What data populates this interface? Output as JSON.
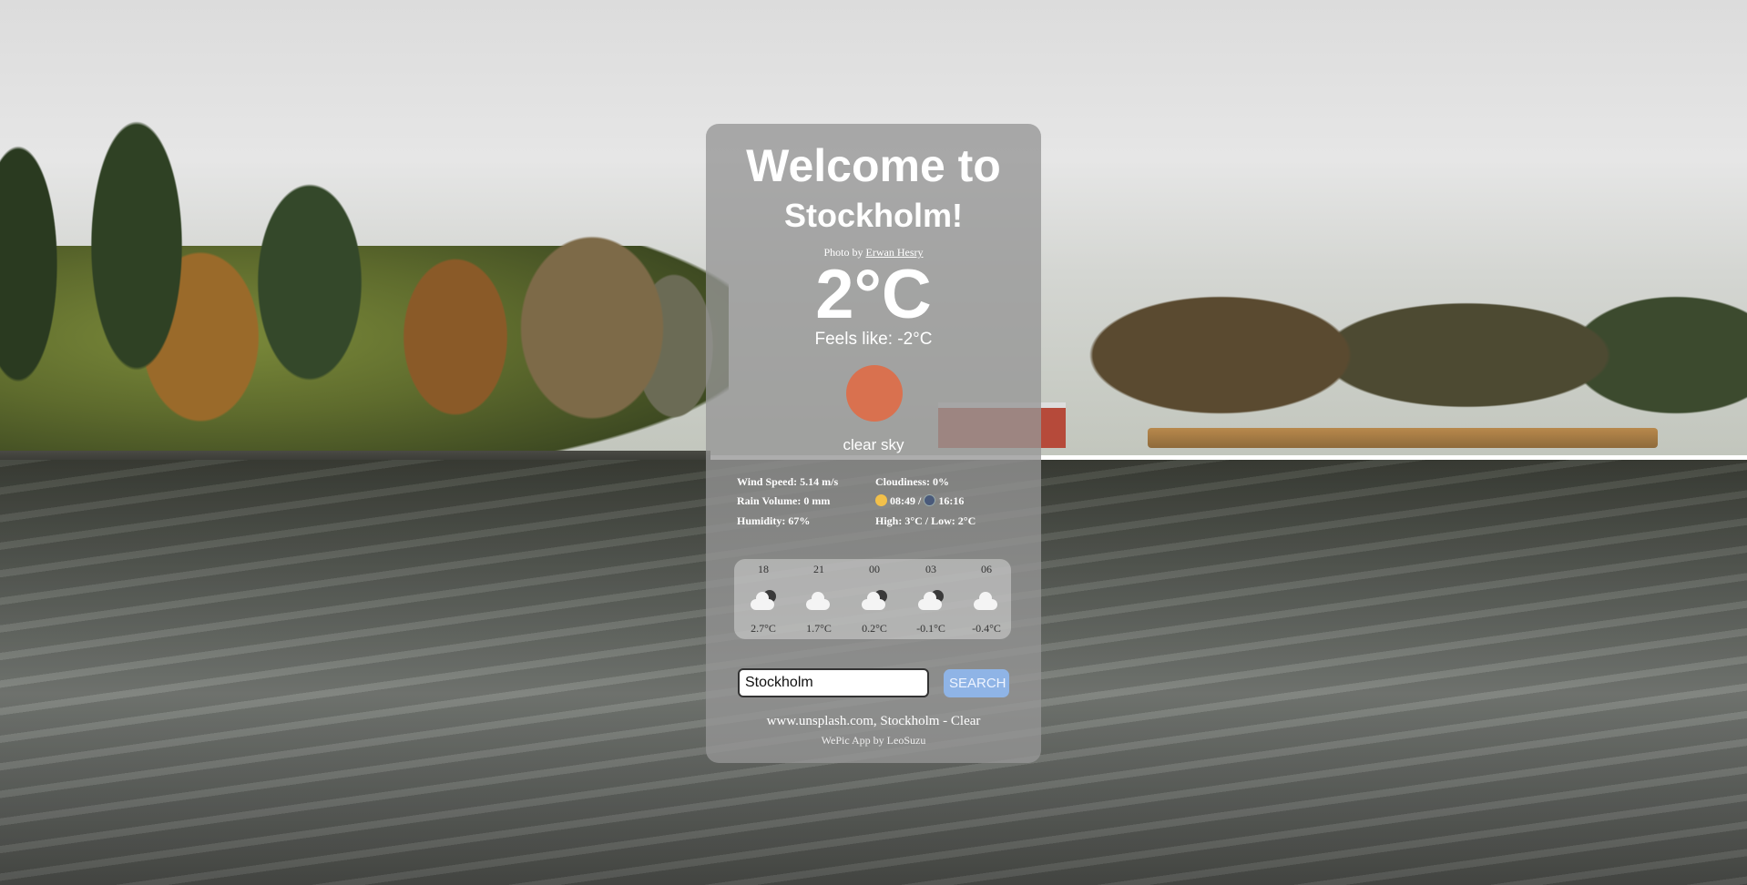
{
  "card": {
    "title_line1": "Welcome to",
    "title_line2": "Stockholm!",
    "photo_credit_prefix": "Photo by",
    "photo_credit_author": "Erwan Hesry",
    "temperature": "2°C",
    "feels_like": "Feels like: -2°C",
    "description": "clear sky"
  },
  "stats": {
    "wind": "Wind Speed: 5.14 m/s",
    "rain": "Rain Volume: 0 mm",
    "humidity": "Humidity: 67%",
    "cloudiness": "Cloudiness: 0%",
    "sunrise": "08:49",
    "sunset": "16:16",
    "sun_separator": "/",
    "high_low": "High: 3°C / Low: 2°C"
  },
  "forecast": [
    {
      "hour": "18",
      "temp": "2.7°C",
      "icon": "cloud-moon-icon"
    },
    {
      "hour": "21",
      "temp": "1.7°C",
      "icon": "cloud-icon"
    },
    {
      "hour": "00",
      "temp": "0.2°C",
      "icon": "cloud-moon-icon"
    },
    {
      "hour": "03",
      "temp": "-0.1°C",
      "icon": "cloud-moon-icon"
    },
    {
      "hour": "06",
      "temp": "-0.4°C",
      "icon": "cloud-icon"
    }
  ],
  "search": {
    "value": "Stockholm",
    "button_label": "SEARCH"
  },
  "footer": {
    "source": "www.unsplash.com, Stockholm - Clear",
    "app": "WePic App by LeoSuzu"
  },
  "colors": {
    "card_bg": "#969696",
    "sun": "#d9714f",
    "search_button": "#8fb4e6"
  }
}
